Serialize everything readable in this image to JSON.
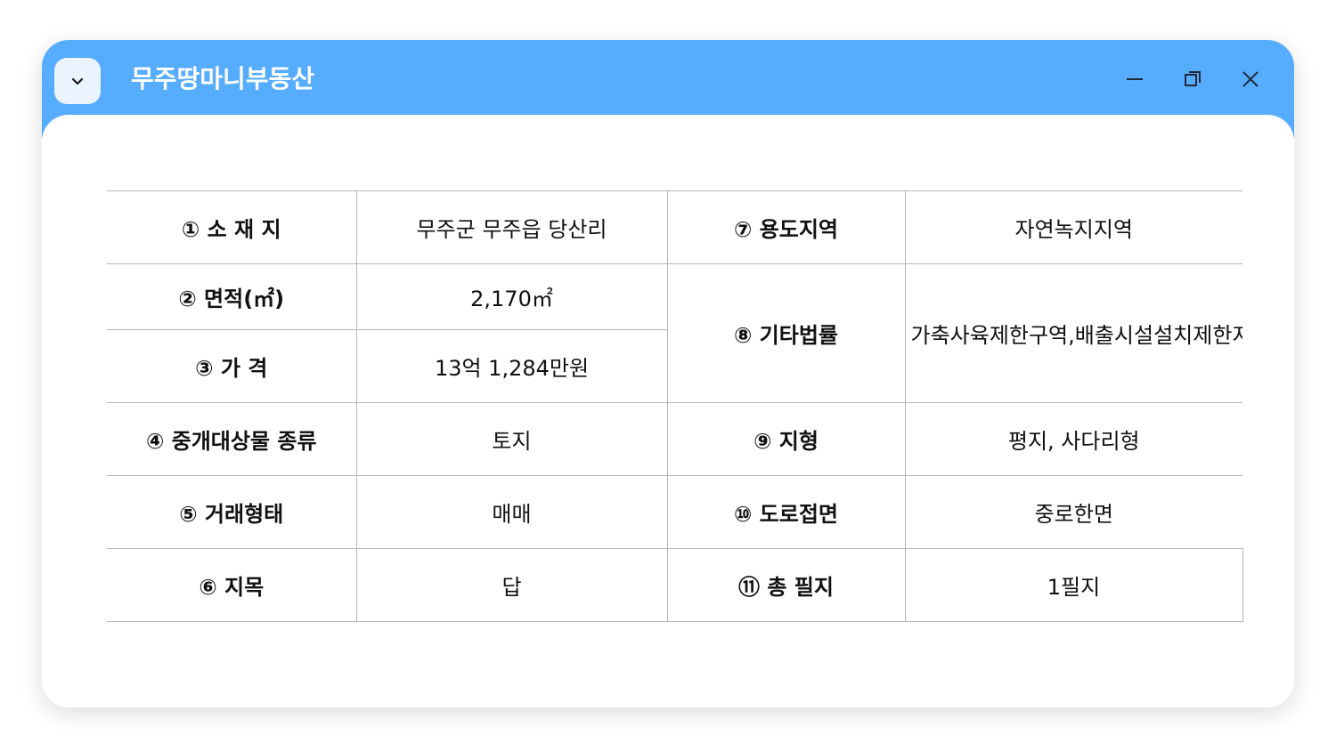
{
  "window": {
    "title": "무주땅마니부동산",
    "colors": {
      "titlebar": "#56acff",
      "collapse_button_bg": "#eaf4ff",
      "background": "#ffffff"
    },
    "icons": {
      "collapse": "chevron-down-icon",
      "minimize": "minimize-icon",
      "maximize": "restore-icon",
      "close": "close-icon"
    }
  },
  "table": {
    "r1": {
      "label_a": "① 소 재 지",
      "value_a": "무주군 무주읍 당산리",
      "label_b": "⑦ 용도지역",
      "value_b": "자연녹지지역"
    },
    "r2": {
      "label_a": "② 면적(㎡)",
      "value_a": "2,170㎡",
      "label_b": "⑧ 기타법률",
      "value_b": "가축사육제한구역,배출시설설치제한지역"
    },
    "r3": {
      "label_a": "③ 가 격",
      "value_a": "13억 1,284만원"
    },
    "r4": {
      "label_a": "④ 중개대상물 종류",
      "value_a": "토지",
      "label_b": "⑨ 지형",
      "value_b": "평지, 사다리형"
    },
    "r5": {
      "label_a": "⑤ 거래형태",
      "value_a": "매매",
      "label_b": "⑩ 도로접면",
      "value_b": "중로한면"
    },
    "r6": {
      "label_a": "⑥  지목",
      "value_a": "답",
      "label_b": "⑪ 총 필지",
      "value_b": "1필지"
    }
  }
}
